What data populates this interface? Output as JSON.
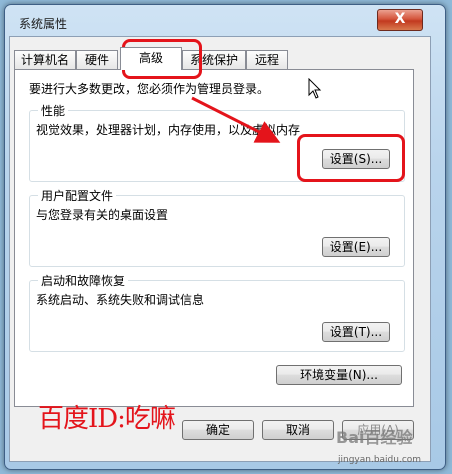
{
  "window": {
    "title": "系统属性",
    "close_label": "X"
  },
  "tabs": [
    {
      "label": "计算机名"
    },
    {
      "label": "硬件"
    },
    {
      "label": "高级",
      "active": true
    },
    {
      "label": "系统保护"
    },
    {
      "label": "远程"
    }
  ],
  "notice": "要进行大多数更改，您必须作为管理员登录。",
  "groups": {
    "performance": {
      "title": "性能",
      "description": "视觉效果，处理器计划，内存使用，以及虚拟内存",
      "button": "设置(S)..."
    },
    "user_profiles": {
      "title": "用户配置文件",
      "description": "与您登录有关的桌面设置",
      "button": "设置(E)..."
    },
    "startup_recovery": {
      "title": "启动和故障恢复",
      "description": "系统启动、系统失败和调试信息",
      "button": "设置(T)..."
    }
  },
  "env_button": "环境变量(N)...",
  "footer": {
    "ok": "确定",
    "cancel": "取消",
    "apply": "应用(A)"
  },
  "watermarks": {
    "author": "百度ID:吃嘛",
    "site_logo": "Bai百经验",
    "site_url": "jingyan.baidu.com"
  },
  "colors": {
    "annotation_red": "#e4141b"
  }
}
